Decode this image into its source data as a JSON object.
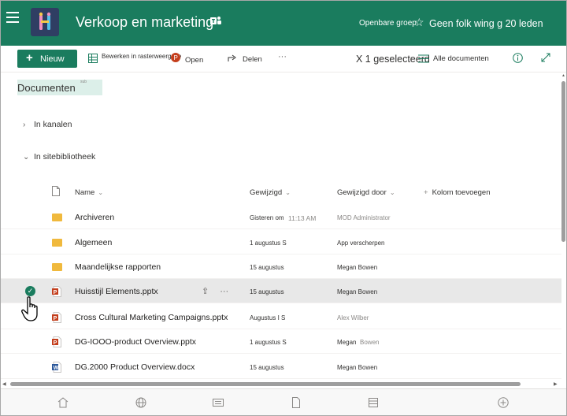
{
  "header": {
    "site_title": "Verkoop en marketing",
    "group_type": "Openbare groep",
    "follow_text": "Geen folk wing g 20 leden"
  },
  "commandbar": {
    "new_label": "Nieuw",
    "edit_grid_label": "Bewerken in rasterweergave",
    "open_label": "Open",
    "share_label": "Delen",
    "more_label": "···",
    "selected_count": "X 1 geselecteerd",
    "view_label": "Alle documenten"
  },
  "library": {
    "title": "Documenten",
    "title_superscript": "sub",
    "groups": [
      "In kanalen",
      "In sitebibliotheek"
    ]
  },
  "columns": {
    "name": "Name",
    "modified": "Gewijzigd",
    "modified_by": "Gewijzigd door",
    "add_column": "Kolom toevoegen"
  },
  "rows": [
    {
      "type": "folder",
      "name": "Archiveren",
      "modified": "Gisteren om",
      "modified_time": "11:13 AM",
      "by": "MOD Administrator",
      "by_muted": true,
      "by2": ""
    },
    {
      "type": "folder",
      "name": "Algemeen",
      "modified": "1 augustus S",
      "modified_time": "",
      "by": "App verscherpen",
      "by_muted": false,
      "by2": ""
    },
    {
      "type": "folder",
      "name": "Maandelijkse rapporten",
      "modified": "15 augustus",
      "modified_time": "",
      "by": "Megan Bowen",
      "by_muted": false,
      "by2": ""
    },
    {
      "type": "pptx",
      "name": "Huisstijl Elements.pptx",
      "modified": "15 augustus",
      "modified_time": "",
      "by": "Megan Bowen",
      "by_muted": false,
      "by2": "",
      "selected": true
    },
    {
      "type": "pptx",
      "name": "Cross Cultural Marketing Campaigns.pptx",
      "modified": "Augustus I S",
      "modified_time": "",
      "by": "Alex Wilber",
      "by_muted": true,
      "by2": ""
    },
    {
      "type": "pptx",
      "name": "DG-IOOO-product Overview.pptx",
      "modified": "1 augustus S",
      "modified_time": "",
      "by": "Megan",
      "by_muted": false,
      "by2": "Bowen"
    },
    {
      "type": "docx",
      "name": "DG.2000 Product Overview.docx",
      "modified": "15 augustus",
      "modified_time": "",
      "by": "Megan Bowen",
      "by_muted": false,
      "by2": ""
    }
  ],
  "colors": {
    "brand": "#1a7c5e",
    "pptx": "#c43e1c",
    "docx": "#2b579a",
    "folder": "#f0b93d"
  },
  "bottomnav": [
    "home-icon",
    "globe-icon",
    "news-icon",
    "file-icon",
    "list-icon",
    "add-icon"
  ]
}
